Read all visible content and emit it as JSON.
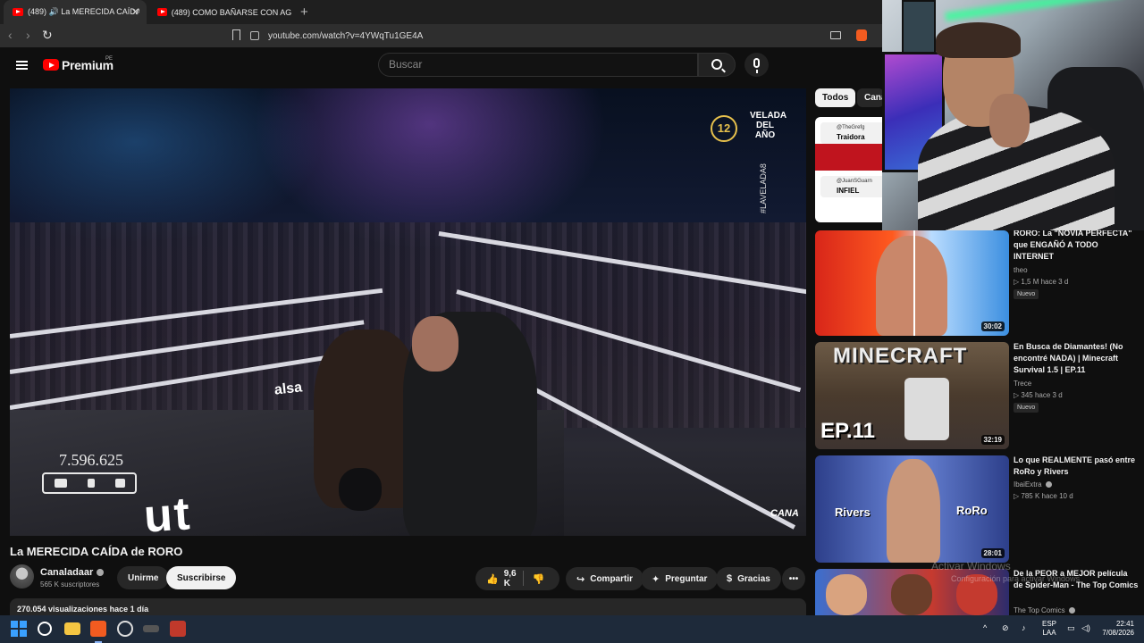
{
  "browser": {
    "tabs": [
      {
        "title": "(489) 🔊 La MERECIDA CAÍDA de RORO",
        "active": true
      },
      {
        "title": "(489) COMO BAÑARSE CON AGUA Y",
        "active": false
      }
    ],
    "url": "youtube.com/watch?v=4YWqTu1GE4A"
  },
  "youtube": {
    "brand": "Premium",
    "country": "PE",
    "search_placeholder": "Buscar"
  },
  "player": {
    "overlay_viewers": "7.596.625",
    "badge_age": "12",
    "event_logo": "VELADA DEL AÑO",
    "hashtag": "#LAVELADA8",
    "watermark": "CANA",
    "ring_text": "ut",
    "ring_apron": "alsa"
  },
  "video": {
    "title": "La MERECIDA CAÍDA de RORO",
    "channel": "Canaladaar",
    "subscribers": "565 K suscriptores",
    "join_label": "Unirme",
    "subscribe_label": "Suscribirse",
    "likes": "9,6 K",
    "share_label": "Compartir",
    "ask_label": "Preguntar",
    "thanks_label": "Gracias",
    "views_date": "270.054 visualizaciones  hace 1 día"
  },
  "sidebar": {
    "chips": [
      "Todos",
      "Canal"
    ],
    "first_thumb_tags": [
      "@TheGrefg",
      "Traidora",
      "@JuanSGuarn",
      "INFIEL"
    ],
    "items": [
      {
        "title": "RORO: La \"NOVIA PERFECTA\" que ENGAÑÓ A TODO INTERNET",
        "channel": "theo",
        "meta": "▷ 1,5 M  hace 3 d",
        "badge": "Nuevo",
        "duration": "30:02"
      },
      {
        "title": "En Busca de Diamantes! (No encontré NADA) | Minecraft Survival 1.5 | EP.11",
        "channel": "Trece",
        "meta": "▷ 345  hace 3 d",
        "badge": "Nuevo",
        "duration": "32:19",
        "thumb_text_top": "MINECRAFT",
        "thumb_text_bottom": "EP.11"
      },
      {
        "title": "Lo que REALMENTE pasó entre RoRo y Rivers",
        "channel": "IbaiExtra",
        "meta": "▷ 785 K  hace 10 d",
        "badge": "",
        "duration": "28:01",
        "thumb_left": "Rivers",
        "thumb_right": "RoRo"
      },
      {
        "title": "De la PEOR a MEJOR película de Spider-Man - The Top Comics",
        "channel": "The Top Comics",
        "meta": "",
        "badge": "",
        "duration": ""
      }
    ]
  },
  "windows": {
    "activate_line1": "Activar Windows",
    "activate_line2": "Configuración para activar Windows",
    "lang_line1": "ESP",
    "lang_line2": "LAA",
    "time": "22:41",
    "date": "7/08/2026"
  }
}
